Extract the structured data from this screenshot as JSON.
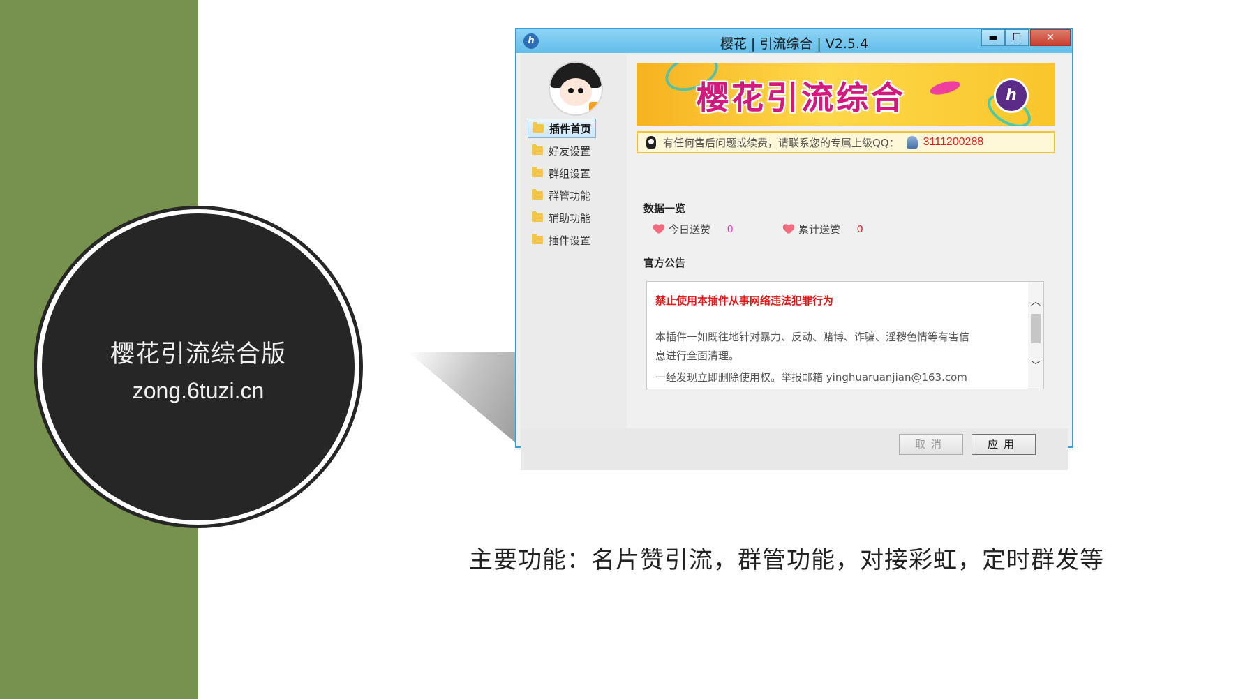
{
  "slide": {
    "circle_title": "樱花引流综合版",
    "circle_url": "zong.6tuzi.cn",
    "caption": "主要功能：名片赞引流，群管功能，对接彩虹，定时群发等"
  },
  "window": {
    "title": "樱花 | 引流综合 | V2.5.4",
    "controls": {
      "minimize": "▬",
      "maximize": "☐",
      "close": "✕"
    },
    "app_icon": "ℎ"
  },
  "sidebar": {
    "items": [
      {
        "label": "插件首页",
        "active": true
      },
      {
        "label": "好友设置"
      },
      {
        "label": "群组设置"
      },
      {
        "label": "群管功能"
      },
      {
        "label": "辅助功能"
      },
      {
        "label": "插件设置"
      }
    ]
  },
  "banner": {
    "text": "樱花引流综合",
    "logo": "ℎ"
  },
  "notice": {
    "text": "有任何售后问题或续费，请联系您的专属上级QQ：",
    "qq": "3111200288"
  },
  "data_overview": {
    "title": "数据一览",
    "today_label": "今日送赞",
    "today_value": "0",
    "total_label": "累计送赞",
    "total_value": "0"
  },
  "announcement": {
    "title": "官方公告",
    "heading": "禁止使用本插件从事网络违法犯罪行为",
    "line1": "本插件一如既往地针对暴力、反动、赌博、诈骗、淫秽色情等有害信",
    "line2": "息进行全面清理。",
    "line3": "一经发现立即删除使用权。举报邮箱 yinghuaruanjian@163.com"
  },
  "buttons": {
    "cancel": "取消",
    "apply": "应用"
  },
  "colors": {
    "green_band": "#77924f",
    "circle": "#262626",
    "window_border": "#3a9ed6",
    "accent_red": "#e02020"
  }
}
